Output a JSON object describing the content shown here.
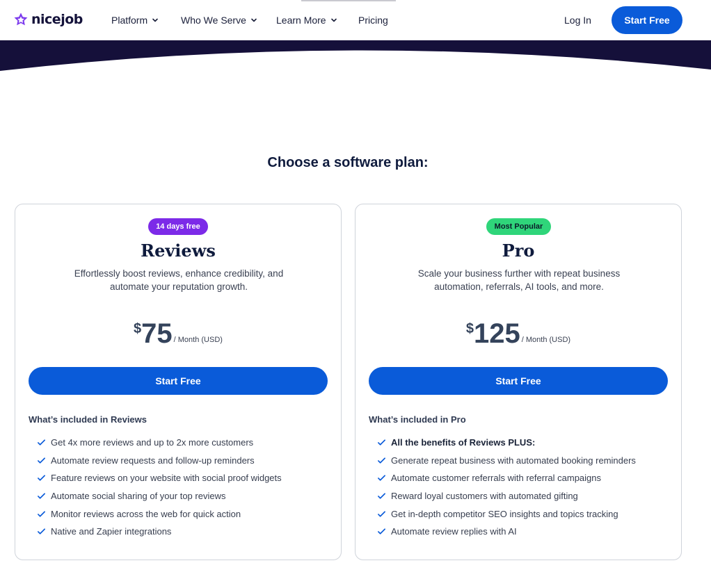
{
  "header": {
    "logo_text": "nicejob",
    "nav": [
      {
        "label": "Platform",
        "has_dropdown": true
      },
      {
        "label": "Who We Serve",
        "has_dropdown": true
      },
      {
        "label": "Learn More",
        "has_dropdown": true
      },
      {
        "label": "Pricing",
        "has_dropdown": false
      }
    ],
    "login_label": "Log In",
    "cta_label": "Start Free"
  },
  "section_title": "Choose a software plan:",
  "colors": {
    "brand_blue": "#0a5bd9",
    "dark_band": "#15103a",
    "badge_purple": "#7c2ae8",
    "badge_green": "#2fd57a",
    "check_blue": "#0a5bd9"
  },
  "plans": [
    {
      "badge": "14 days free",
      "name": "Reviews",
      "description": "Effortlessly boost reviews, enhance credibility, and automate your reputation growth.",
      "currency": "$",
      "price": "75",
      "period": "/ Month (USD)",
      "cta_label": "Start Free",
      "included_heading": "What’s included in Reviews",
      "features": [
        "Get 4x more reviews and up to 2x more customers",
        "Automate review requests and follow-up reminders",
        "Feature reviews on your website with social proof widgets",
        "Automate social sharing of your top reviews",
        "Monitor reviews across the web for quick action",
        "Native and Zapier integrations"
      ]
    },
    {
      "badge": "Most Popular",
      "name": "Pro",
      "description": "Scale your business further with repeat business automation, referrals, AI tools, and more.",
      "currency": "$",
      "price": "125",
      "period": "/ Month (USD)",
      "cta_label": "Start Free",
      "included_heading": "What’s included in Pro",
      "features": [
        "All the benefits of Reviews PLUS:",
        "Generate repeat business with automated booking reminders",
        "Automate customer referrals with referral campaigns",
        "Reward loyal customers with automated gifting",
        "Get in-depth competitor SEO insights and topics tracking",
        "Automate review replies with AI"
      ]
    }
  ]
}
